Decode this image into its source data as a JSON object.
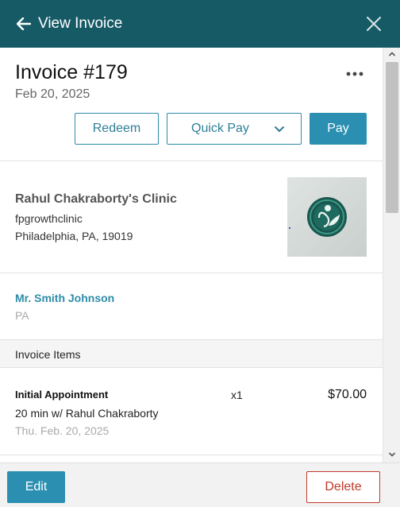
{
  "header": {
    "title": "View Invoice",
    "back_icon": "arrow-left-icon",
    "close_icon": "close-icon",
    "background": "#165a66"
  },
  "invoice": {
    "title": "Invoice #179",
    "date": "Feb 20, 2025",
    "more_icon": "more-horizontal-icon"
  },
  "actions": {
    "redeem_label": "Redeem",
    "quick_pay_label": "Quick Pay",
    "pay_label": "Pay"
  },
  "clinic": {
    "name": "Rahul Chakraborty's Clinic",
    "handle": "fpgrowthclinic",
    "address": "Philadelphia, PA, 19019"
  },
  "patient": {
    "name": "Mr. Smith Johnson",
    "state": "PA"
  },
  "items": {
    "header": "Invoice Items",
    "rows": [
      {
        "name": "Initial Appointment",
        "qty": "x1",
        "price": "$70.00",
        "description": "20 min w/ Rahul Chakraborty",
        "date": "Thu. Feb. 20, 2025"
      }
    ]
  },
  "footer": {
    "edit_label": "Edit",
    "delete_label": "Delete"
  },
  "colors": {
    "accent": "#2b8fb1",
    "danger": "#c0392b"
  }
}
